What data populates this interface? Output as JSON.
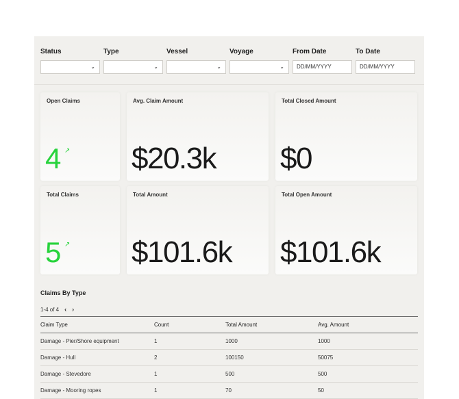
{
  "filters": [
    {
      "label": "Status",
      "value": "",
      "type": "select"
    },
    {
      "label": "Type",
      "value": "",
      "type": "select"
    },
    {
      "label": "Vessel",
      "value": "",
      "type": "select"
    },
    {
      "label": "Voyage",
      "value": "",
      "type": "select"
    },
    {
      "label": "From Date",
      "placeholder": "DD/MM/YYYY",
      "type": "date"
    },
    {
      "label": "To Date",
      "placeholder": "DD/MM/YYYY",
      "type": "date"
    }
  ],
  "cards": {
    "open_claims": {
      "label": "Open Claims",
      "value": "4"
    },
    "avg_claim_amount": {
      "label": "Avg. Claim Amount",
      "value": "$20.3k"
    },
    "total_closed_amount": {
      "label": "Total Closed Amount",
      "value": "$0"
    },
    "total_claims": {
      "label": "Total Claims",
      "value": "5"
    },
    "total_amount": {
      "label": "Total Amount",
      "value": "$101.6k"
    },
    "total_open_amount": {
      "label": "Total Open Amount",
      "value": "$101.6k"
    }
  },
  "claims_by_type": {
    "title": "Claims By Type",
    "pagination": "1-4 of 4",
    "columns": [
      "Claim Type",
      "Count",
      "Total Amount",
      "Avg. Amount"
    ],
    "rows": [
      [
        "Damage - Pier/Shore equipment",
        "1",
        "1000",
        "1000"
      ],
      [
        "Damage - Hull",
        "2",
        "100150",
        "50075"
      ],
      [
        "Damage - Stevedore",
        "1",
        "500",
        "500"
      ],
      [
        "Damage - Mooring ropes",
        "1",
        "70",
        "50"
      ]
    ]
  },
  "colors": {
    "accent_green": "#27d33c",
    "panel_bg": "#f1f0ed"
  },
  "icons": {
    "select": "chevron-down-icon",
    "trend": "arrow-up-right-icon",
    "prev": "chevron-left-icon",
    "next": "chevron-right-icon"
  }
}
